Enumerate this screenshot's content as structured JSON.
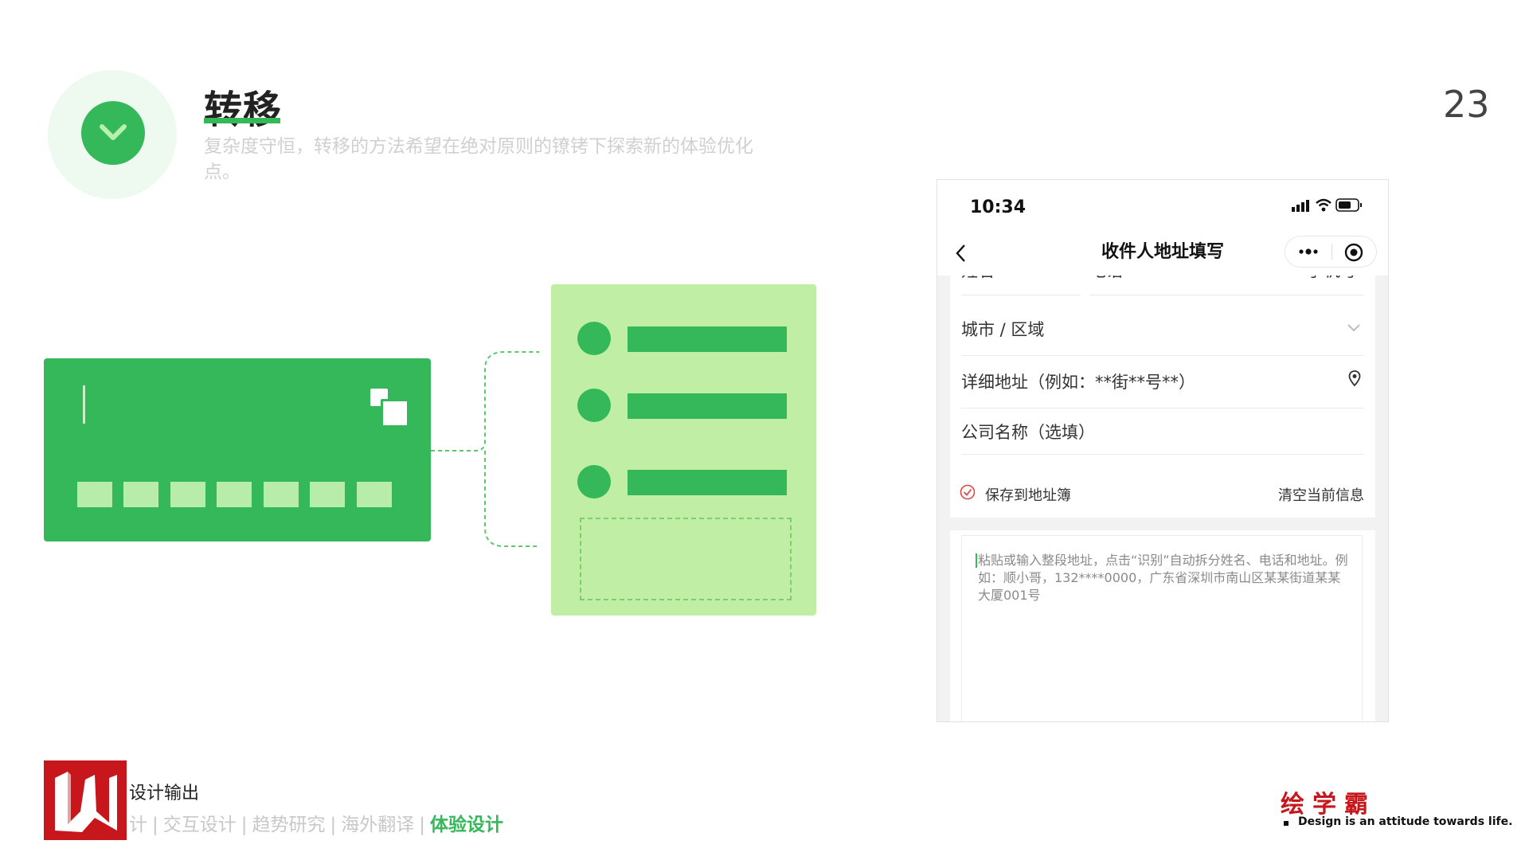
{
  "header": {
    "title": "转移",
    "subtitle": "复杂度守恒，转移的方法希望在绝对原则的镣铐下探索新的体验优化点。",
    "page_number": "23"
  },
  "colors": {
    "accent": "#34b85a",
    "panel_bg": "#bfeea4",
    "brand_red": "#c8161d"
  },
  "phone": {
    "status": {
      "time": "10:34",
      "icons": [
        "signal-icon",
        "wifi-icon",
        "battery-icon"
      ]
    },
    "navbar": {
      "title": "收件人地址填写",
      "back_icon": "chevron-left-icon",
      "more_icon": "more-dots-icon",
      "close_icon": "target-circle-icon"
    },
    "form": {
      "clipped_labels": [
        "姓名",
        "电话",
        "手机号"
      ],
      "city_label": "城市 / 区域",
      "detail_label": "详细地址（例如：**街**号**）",
      "company_label": "公司名称（选填）",
      "save_label": "保存到地址簿",
      "save_checked": true,
      "clear_label": "清空当前信息"
    },
    "paste": {
      "placeholder": "粘贴或输入整段地址，点击“识别”自动拆分姓名、电话和地址。例如：顺小哥，132****0000，广东省深圳市南山区某某街道某某大厦001号"
    }
  },
  "footer": {
    "top_text": "设计输出",
    "nav": {
      "item0": "计",
      "item1": "交互设计",
      "item2": "趋势研究",
      "item3": "海外翻译",
      "item4": "体验设计",
      "active_index": 4
    },
    "brand_cn": "绘学霸",
    "brand_en": "Design is an attitude towards life."
  }
}
